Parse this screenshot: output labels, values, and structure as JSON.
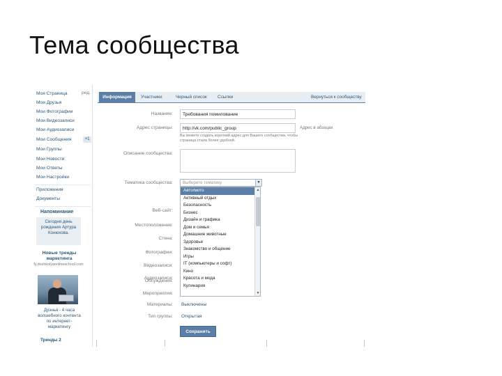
{
  "slide": {
    "title": "Тема сообщества"
  },
  "sidebar": {
    "edit_label": "ред.",
    "items": [
      {
        "label": "Моя Страница"
      },
      {
        "label": "Мои Друзья"
      },
      {
        "label": "Мои Фотографии"
      },
      {
        "label": "Мои Видеозаписи"
      },
      {
        "label": "Мои Аудиозаписи"
      },
      {
        "label": "Мои Сообщения",
        "badge": "+1"
      },
      {
        "label": "Мои Группы"
      },
      {
        "label": "Мои Новости"
      },
      {
        "label": "Мои Ответы"
      },
      {
        "label": "Мои Настройки"
      }
    ],
    "extra_items": [
      {
        "label": "Приложения"
      },
      {
        "label": "Документы"
      }
    ],
    "reminder": {
      "title": "Напоминание",
      "text": "Сегодня день рождения Артура Конюхова."
    },
    "ad": {
      "title": "Новые тренды маркетинга",
      "url": "fy.doshkolyaonlineschool.com",
      "text": "Дуэнья - 4 часа волшебного контента по интернет-маркетингу",
      "more": "Тренды 2"
    }
  },
  "tabs": [
    {
      "label": "Информация",
      "active": true
    },
    {
      "label": "Участники",
      "active": false
    },
    {
      "label": "Черный список",
      "active": false
    },
    {
      "label": "Ссылки",
      "active": false
    },
    {
      "label": "Вернуться к сообществу",
      "active": false
    }
  ],
  "form": {
    "name_label": "Название:",
    "name_value": "Требования помилование",
    "address_label": "Адрес страницы:",
    "address_value": "http://vk.com/public_group",
    "address_side": "Адрес в абзацах",
    "address_hint": "Вы можете создать короткий адрес для Вашего сообщества, чтобы страница стала более удобной.",
    "description_label": "Описание сообщества:",
    "topic_label": "Тематика сообщества:",
    "topic_placeholder": "Выберите тематику",
    "topic_options": [
      {
        "label": "Авто/мото",
        "selected": true
      },
      {
        "label": "Активный отдых"
      },
      {
        "label": "Безопасность"
      },
      {
        "label": "Бизнес"
      },
      {
        "label": "Дизайн и графика"
      },
      {
        "label": "Дом и семья"
      },
      {
        "label": "Домашние животные"
      },
      {
        "label": "Здоровье"
      },
      {
        "label": "Знакомство и общение"
      },
      {
        "label": "Игры"
      },
      {
        "label": "IT (компьютеры и софт)"
      },
      {
        "label": "Кино"
      },
      {
        "label": "Красота и мода"
      },
      {
        "label": "Кулинария"
      }
    ],
    "website_label": "Веб-сайт:",
    "location_label": "Местоположение:",
    "wall_label": "Стена:",
    "photos_label": "Фотографии:",
    "videos_label": "Видеозаписи:",
    "audio_label": "Аудиозаписи:",
    "discussions_label": "Обсуждения:",
    "events_label": "Мероприятия:",
    "materials_label": "Материалы:",
    "materials_value": "Выключены",
    "group_type_label": "Тип группы:",
    "group_type_value": "Открытая",
    "save_label": "Сохранить"
  }
}
